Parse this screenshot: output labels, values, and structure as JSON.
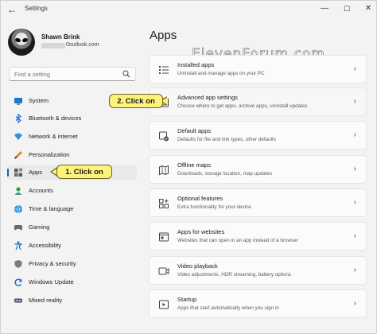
{
  "window": {
    "title": "Settings",
    "back_glyph": "←",
    "minimize_glyph": "—",
    "maximize_glyph": "☐",
    "close_glyph": "✕"
  },
  "profile": {
    "name": "Shawn Brink",
    "email_suffix": "0outlook.com"
  },
  "search": {
    "placeholder": "Find a setting"
  },
  "sidebar": {
    "items": [
      {
        "label": "System",
        "icon": "system-icon"
      },
      {
        "label": "Bluetooth & devices",
        "icon": "bluetooth-icon"
      },
      {
        "label": "Network & internet",
        "icon": "wifi-icon"
      },
      {
        "label": "Personalization",
        "icon": "paintbrush-icon"
      },
      {
        "label": "Apps",
        "icon": "apps-icon",
        "selected": true
      },
      {
        "label": "Accounts",
        "icon": "accounts-icon"
      },
      {
        "label": "Time & language",
        "icon": "globe-clock-icon"
      },
      {
        "label": "Gaming",
        "icon": "gamepad-icon"
      },
      {
        "label": "Accessibility",
        "icon": "accessibility-icon"
      },
      {
        "label": "Privacy & security",
        "icon": "shield-icon"
      },
      {
        "label": "Windows Update",
        "icon": "update-icon"
      },
      {
        "label": "Mixed reality",
        "icon": "headset-icon"
      }
    ]
  },
  "main": {
    "title": "Apps",
    "watermark": "ElevenForum.com",
    "cards": [
      {
        "title": "Installed apps",
        "desc": "Uninstall and manage apps on your PC",
        "icon": "installed-apps-icon"
      },
      {
        "title": "Advanced app settings",
        "desc": "Choose where to get apps, archive apps, uninstall updates",
        "icon": "advanced-settings-icon"
      },
      {
        "title": "Default apps",
        "desc": "Defaults for file and link types, other defaults",
        "icon": "default-apps-icon"
      },
      {
        "title": "Offline maps",
        "desc": "Downloads, storage location, map updates",
        "icon": "map-icon"
      },
      {
        "title": "Optional features",
        "desc": "Extra functionality for your device",
        "icon": "optional-features-icon"
      },
      {
        "title": "Apps for websites",
        "desc": "Websites that can open in an app instead of a browser",
        "icon": "apps-websites-icon"
      },
      {
        "title": "Video playback",
        "desc": "Video adjustments, HDR streaming, battery options",
        "icon": "video-icon"
      },
      {
        "title": "Startup",
        "desc": "Apps that start automatically when you sign in",
        "icon": "startup-icon"
      }
    ],
    "chevron_glyph": "›"
  },
  "callouts": {
    "step1": "1. Click on",
    "step2": "2. Click on"
  },
  "colors": {
    "accent": "#0067c0",
    "callout_fill": "#fdf37a",
    "background": "#f3f3f3",
    "card": "#fbfbfb"
  }
}
